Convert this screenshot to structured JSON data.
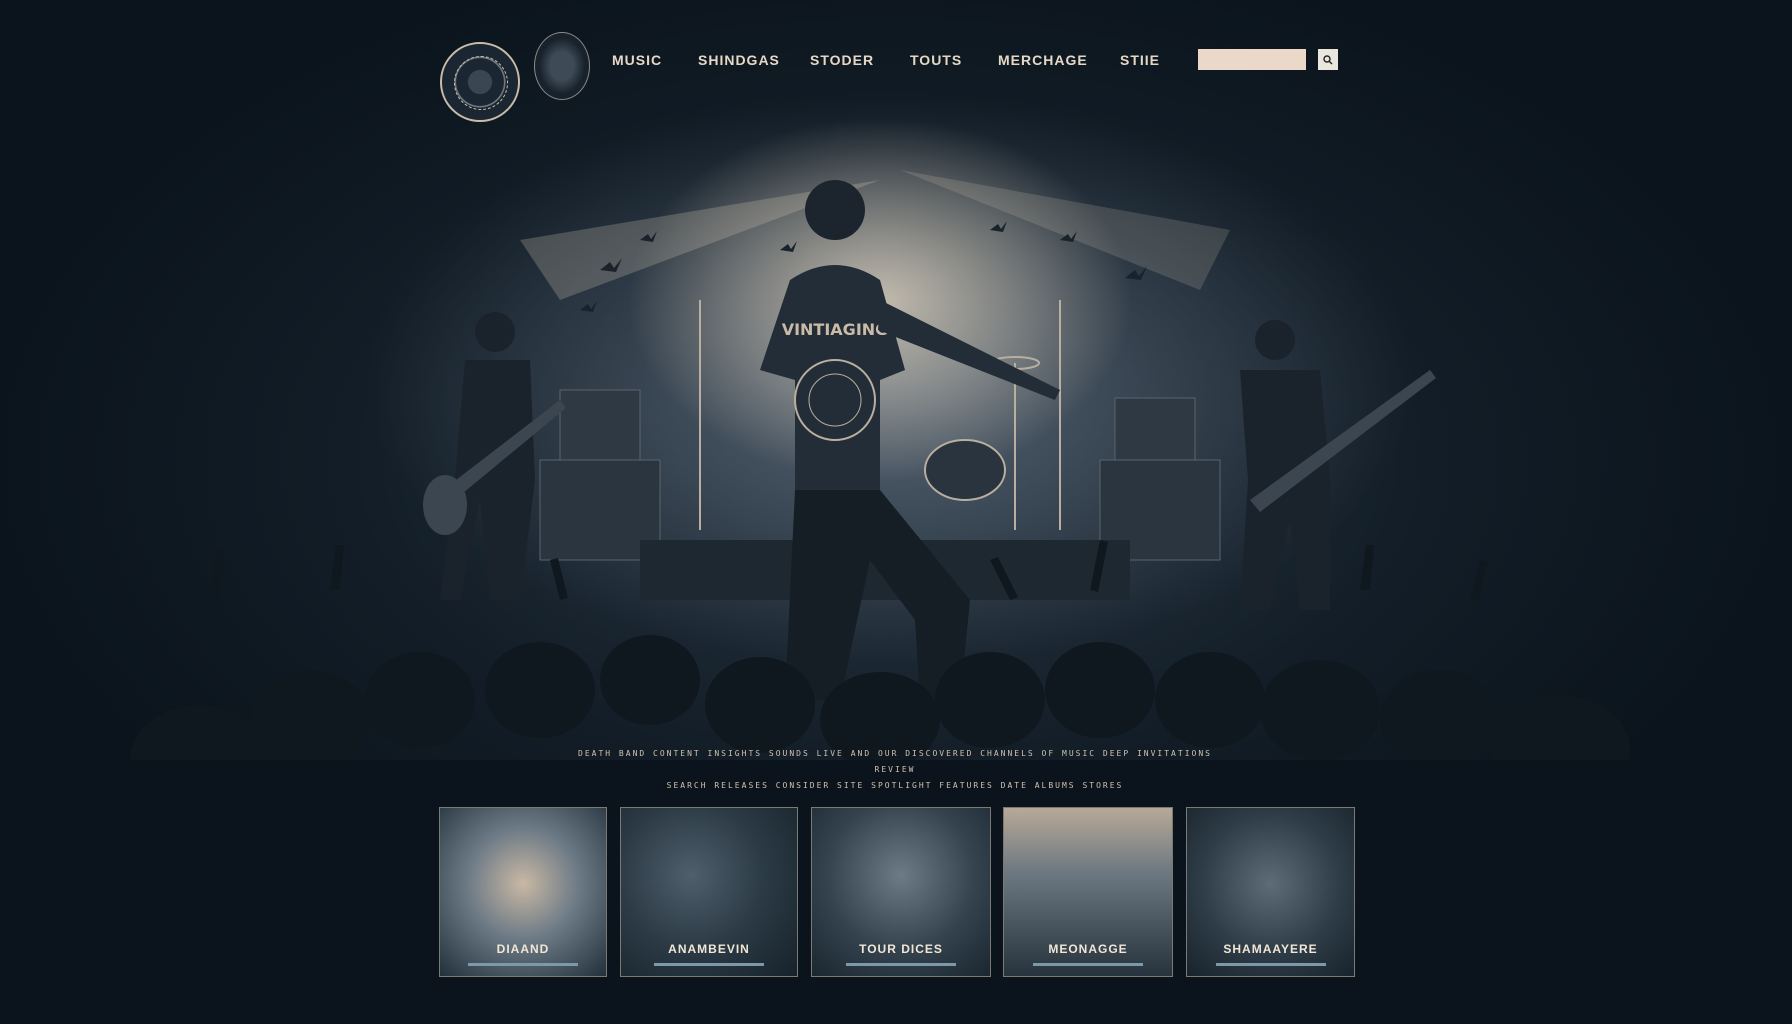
{
  "nav": {
    "items": [
      {
        "label": "MUSIC"
      },
      {
        "label": "SHINDGAS"
      },
      {
        "label": "STODER"
      },
      {
        "label": "TOUTS"
      },
      {
        "label": "MERCHAGE"
      },
      {
        "label": "STIIE"
      }
    ],
    "search_value": ""
  },
  "tagline": {
    "line1": "DEATH  BAND  CONTENT  INSIGHTS  SOUNDS  LIVE  AND  OUR  DISCOVERED  CHANNELS  OF  MUSIC  DEEP  INVITATIONS  REVIEW",
    "line2": "SEARCH  RELEASES  CONSIDER  SITE  SPOTLIGHT  FEATURES  DATE  ALBUMS  STORES"
  },
  "shirt_text": "VINTIAGING",
  "cards": [
    {
      "label": "DIAAND"
    },
    {
      "label": "ANAMBEVIN"
    },
    {
      "label": "TOUR DICES"
    },
    {
      "label": "MEONAGGE"
    },
    {
      "label": "SHAMAAYERE"
    }
  ],
  "colors": {
    "background": "#0b141c",
    "cream": "#e9dccd",
    "accent_bar": "#7d98a8"
  }
}
